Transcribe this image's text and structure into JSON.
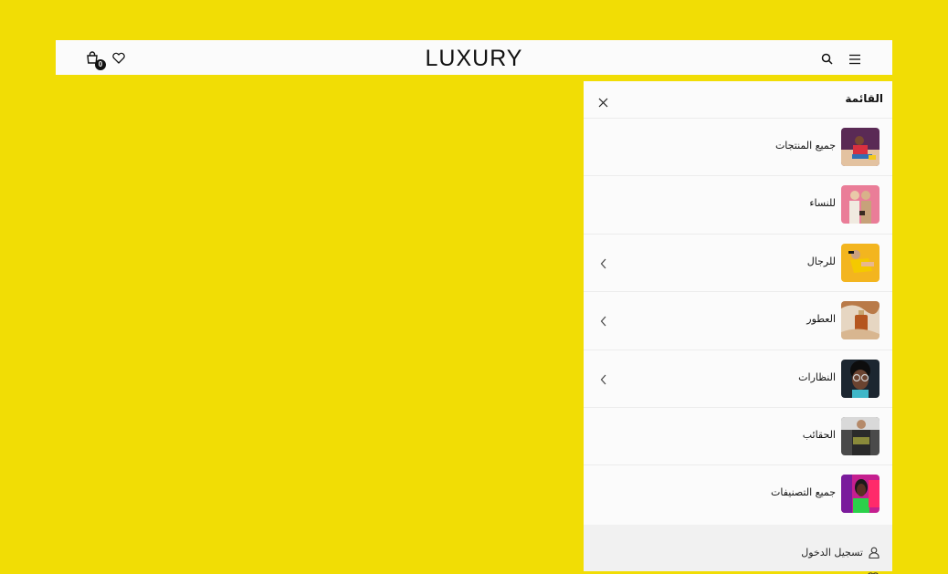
{
  "header": {
    "logo": "LUXURY",
    "cart_count": "0"
  },
  "drawer": {
    "title": "القائمة",
    "items": [
      {
        "label": "جميع المنتجات",
        "icon": "thumb-all-products",
        "has_submenu": false,
        "color": "#c43a4a"
      },
      {
        "label": "للنساء",
        "icon": "thumb-women",
        "has_submenu": false,
        "color": "#e97a95"
      },
      {
        "label": "للرجال",
        "icon": "thumb-men",
        "has_submenu": true,
        "color": "#f2b821"
      },
      {
        "label": "العطور",
        "icon": "thumb-perfumes",
        "has_submenu": true,
        "color": "#c9905a"
      },
      {
        "label": "النظارات",
        "icon": "thumb-glasses",
        "has_submenu": true,
        "color": "#1f2b36"
      },
      {
        "label": "الحقائب",
        "icon": "thumb-bags",
        "has_submenu": false,
        "color": "#7a6a45"
      },
      {
        "label": "جميع التصنيفات",
        "icon": "thumb-all-categories",
        "has_submenu": false,
        "color": "#d81f8a"
      }
    ],
    "login_label": "تسجيل الدخول"
  },
  "colors": {
    "background": "#f1dd05",
    "panel": "#fbfbfb",
    "footer": "#f1f1f1",
    "text": "#111111"
  }
}
